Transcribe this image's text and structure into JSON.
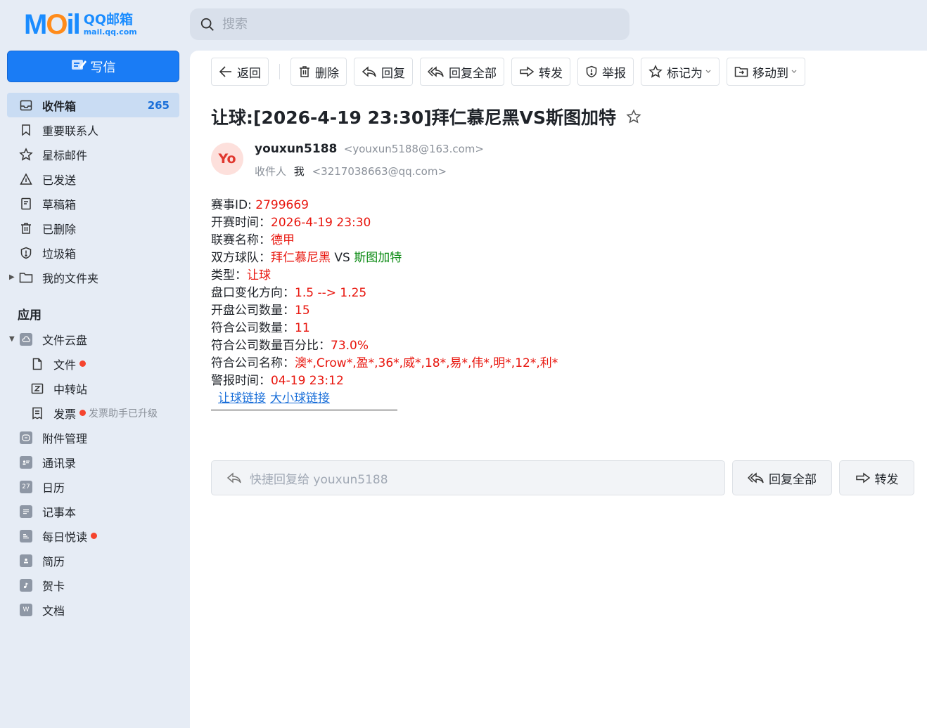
{
  "header": {
    "logo_mark": "MOil",
    "logo_cn": "QQ邮箱",
    "logo_url": "mail.qq.com",
    "search_placeholder": "搜索"
  },
  "sidebar": {
    "compose_label": "写信",
    "items": [
      {
        "label": "收件箱",
        "count": "265",
        "icon": "inbox-icon"
      },
      {
        "label": "重要联系人",
        "icon": "bookmark-icon"
      },
      {
        "label": "星标邮件",
        "icon": "star-icon"
      },
      {
        "label": "已发送",
        "icon": "sent-icon"
      },
      {
        "label": "草稿箱",
        "icon": "draft-icon"
      },
      {
        "label": "已删除",
        "icon": "trash-icon"
      },
      {
        "label": "垃圾箱",
        "icon": "spam-icon"
      },
      {
        "label": "我的文件夹",
        "icon": "folder-icon"
      }
    ],
    "apps_title": "应用",
    "apps": [
      {
        "label": "文件云盘",
        "icon": "cloud-drive-icon"
      },
      {
        "label": "文件",
        "icon": "file-icon"
      },
      {
        "label": "中转站",
        "icon": "transfer-icon"
      },
      {
        "label": "发票",
        "note": "发票助手已升级",
        "icon": "invoice-icon"
      },
      {
        "label": "附件管理",
        "icon": "attachment-icon"
      },
      {
        "label": "通讯录",
        "icon": "contacts-icon"
      },
      {
        "label": "日历",
        "icon": "calendar-icon",
        "badge": "27"
      },
      {
        "label": "记事本",
        "icon": "notepad-icon"
      },
      {
        "label": "每日悦读",
        "icon": "reading-icon"
      },
      {
        "label": "简历",
        "icon": "resume-icon"
      },
      {
        "label": "贺卡",
        "icon": "card-icon"
      },
      {
        "label": "文档",
        "icon": "document-icon",
        "badge": "W"
      }
    ]
  },
  "toolbar": {
    "back": "返回",
    "delete": "删除",
    "reply": "回复",
    "reply_all": "回复全部",
    "forward": "转发",
    "report": "举报",
    "mark_as": "标记为",
    "move_to": "移动到"
  },
  "mail": {
    "subject": "让球:[2026-4-19 23:30]拜仁慕尼黑VS斯图加特",
    "avatar_text": "Yo",
    "sender_name": "youxun5188",
    "sender_addr": "<youxun5188@163.com>",
    "recipient_label": "收件人",
    "recipient_name": "我",
    "recipient_addr": "<3217038663@qq.com>",
    "body": {
      "match_id_label": "赛事ID: ",
      "match_id": "2799669",
      "start_time_label": "开赛时间：",
      "start_time": "2026-4-19 23:30",
      "league_label": "联赛名称：",
      "league": "德甲",
      "teams_label": "双方球队：",
      "home_team": "拜仁慕尼黑",
      "vs": " VS ",
      "away_team": "斯图加特",
      "type_label": "类型：",
      "type": "让球",
      "line_change_label": "盘口变化方向：",
      "line_change": "1.5 --> 1.25",
      "bookmakers_label": "开盘公司数量：",
      "bookmakers": "15",
      "matching_label": "符合公司数量：",
      "matching": "11",
      "matching_pct_label": "符合公司数量百分比：",
      "matching_pct": "73.0%",
      "matching_names_label": "符合公司名称：",
      "matching_names": "澳*,Crow*,盈*,36*,威*,18*,易*,伟*,明*,12*,利*",
      "alert_time_label": "警报时间：",
      "alert_time": "04-19 23:12",
      "link_handicap": "让球链接",
      "link_totals": "大小球链接"
    }
  },
  "quick_reply": {
    "placeholder": "快捷回复给 youxun5188",
    "reply_all": "回复全部",
    "forward": "转发"
  },
  "colors": {
    "accent": "#1a7cf5",
    "highlight_red": "#e8150d",
    "highlight_green": "#0a8a12",
    "sidebar_bg": "#e6ecf5",
    "active_item_bg": "#c9dcf3"
  }
}
